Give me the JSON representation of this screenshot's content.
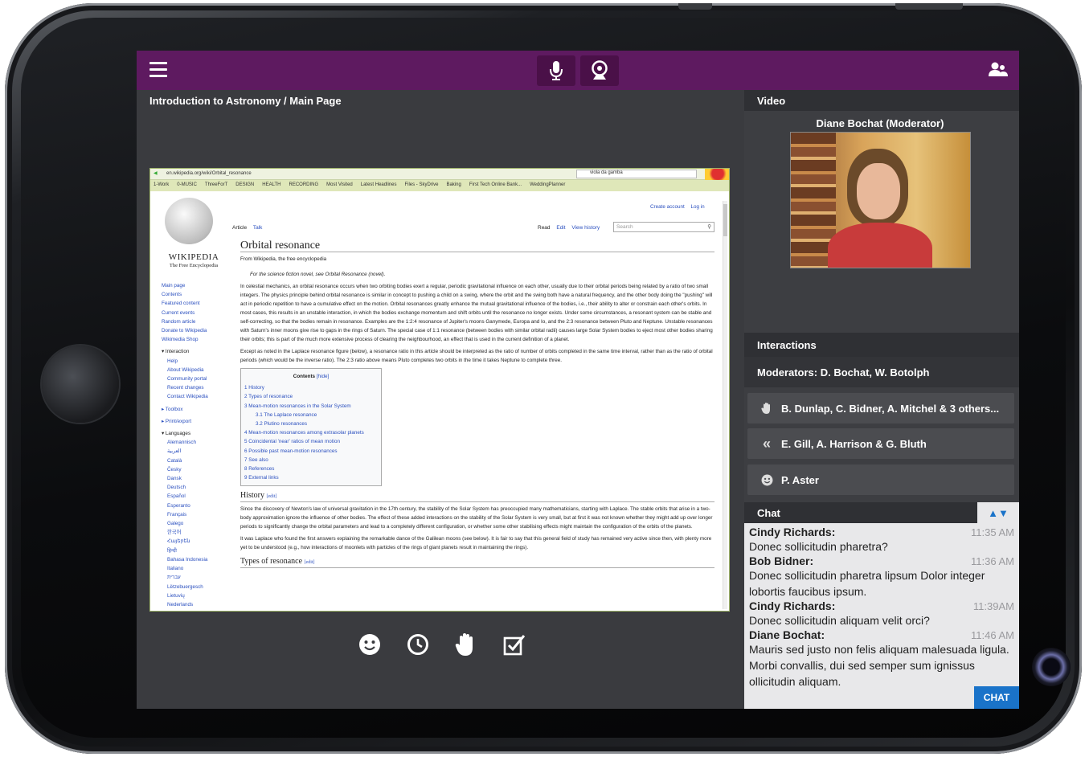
{
  "header": {
    "page_title": "Introduction to Astronomy / Main Page",
    "menu_icon": "hamburger-menu-icon",
    "mic_icon": "microphone-icon",
    "webcam_icon": "webcam-icon",
    "users_icon": "users-icon"
  },
  "video": {
    "section_title": "Video",
    "presenter": "Diane Bochat (Moderator)"
  },
  "interactions": {
    "section_title": "Interactions",
    "moderators": "Moderators: D. Bochat, W. Botolph",
    "rows": [
      {
        "icon": "raised-hand-icon",
        "label": "B. Dunlap, C. Bidner, A. Mitchel & 3 others..."
      },
      {
        "icon": "slower-icon",
        "label": "E. Gill, A. Harrison & G. Bluth"
      },
      {
        "icon": "smiley-icon",
        "label": "P. Aster"
      }
    ]
  },
  "chat": {
    "section_title": "Chat",
    "toggle_label": "▲▼",
    "button_label": "CHAT",
    "messages": [
      {
        "author": "Cindy Richards:",
        "time": "11:35 AM",
        "text": "Donec sollicitudin pharetra?"
      },
      {
        "author": "Bob Bidner:",
        "time": "11:36 AM",
        "text": "Donec sollicitudin pharetra lipsum Dolor integer lobortis faucibus ipsum."
      },
      {
        "author": "Cindy Richards:",
        "time": "11:39AM",
        "text": "Donec sollicitudin aliquam velit orci?"
      },
      {
        "author": "Diane Bochat:",
        "time": "11:46 AM",
        "text": "Mauris sed justo non felis aliquam malesuada ligula. Morbi convallis, dui sed semper sum ignissus ollicitudin aliquam."
      }
    ]
  },
  "bottom_tools": [
    "smiley-icon",
    "clock-icon",
    "raised-hand-icon",
    "checkbox-icon"
  ],
  "browser": {
    "url": "en.wikipedia.org/wiki/Orbital_resonance",
    "search_engine_text": "viola da gamba",
    "bookmarks": [
      "1-Work",
      "0-MUSIC",
      "ThreeForT",
      "DESIGN",
      "HEALTH",
      "RECORDING",
      "Most Visited",
      "Latest Headlines",
      "Files - SkyDrive",
      "Baking",
      "First Tech Online Bank...",
      "WeddingPlanner"
    ]
  },
  "wiki": {
    "logo_title": "WIKIPEDIA",
    "logo_subtitle": "The Free Encyclopedia",
    "create_account": "Create account",
    "log_in": "Log in",
    "tab_article": "Article",
    "tab_talk": "Talk",
    "tab_read": "Read",
    "tab_edit": "Edit",
    "tab_history": "View history",
    "search_placeholder": "Search",
    "nav_main": [
      "Main page",
      "Contents",
      "Featured content",
      "Current events",
      "Random article",
      "Donate to Wikipedia",
      "Wikimedia Shop"
    ],
    "nav_interaction_head": "Interaction",
    "nav_interaction": [
      "Help",
      "About Wikipedia",
      "Community portal",
      "Recent changes",
      "Contact Wikipedia"
    ],
    "nav_toolbox": "Toolbox",
    "nav_print": "Print/export",
    "nav_languages_head": "Languages",
    "nav_languages": [
      "Alemannisch",
      "العربية",
      "Català",
      "Česky",
      "Dansk",
      "Deutsch",
      "Español",
      "Esperanto",
      "Français",
      "Galego",
      "한국어",
      "Հայերեն",
      "हिन्दी",
      "Bahasa Indonesia",
      "Italiano",
      "עברית",
      "Lëtzebuergesch",
      "Lietuvių",
      "Nederlands"
    ],
    "article_title": "Orbital resonance",
    "from_line": "From Wikipedia, the free encyclopedia",
    "hatnote": "For the science fiction novel, see Orbital Resonance (novel).",
    "para1": "In celestial mechanics, an orbital resonance occurs when two orbiting bodies exert a regular, periodic gravitational influence on each other, usually due to their orbital periods being related by a ratio of two small integers. The physics principle behind orbital resonance is similar in concept to pushing a child on a swing, where the orbit and the swing both have a natural frequency, and the other body doing the \"pushing\" will act in periodic repetition to have a cumulative effect on the motion. Orbital resonances greatly enhance the mutual gravitational influence of the bodies, i.e., their ability to alter or constrain each other's orbits. In most cases, this results in an unstable interaction, in which the bodies exchange momentum and shift orbits until the resonance no longer exists. Under some circumstances, a resonant system can be stable and self-correcting, so that the bodies remain in resonance. Examples are the 1:2:4 resonance of Jupiter's moons Ganymede, Europa and Io, and the 2:3 resonance between Pluto and Neptune. Unstable resonances with Saturn's inner moons give rise to gaps in the rings of Saturn. The special case of 1:1 resonance (between bodies with similar orbital radii) causes large Solar System bodies to eject most other bodies sharing their orbits; this is part of the much more extensive process of clearing the neighbourhood, an effect that is used in the current definition of a planet.",
    "para2": "Except as noted in the Laplace resonance figure (below), a resonance ratio in this article should be interpreted as the ratio of number of orbits completed in the same time interval, rather than as the ratio of orbital periods (which would be the inverse ratio). The 2:3 ratio above means Pluto completes two orbits in the time it takes Neptune to complete three.",
    "toc_title": "Contents",
    "toc_hide": "[hide]",
    "toc": [
      "1 History",
      "2 Types of resonance",
      "3 Mean-motion resonances in the Solar System",
      "3.1 The Laplace resonance",
      "3.2 Plutino resonances",
      "4 Mean-motion resonances among extrasolar planets",
      "5 Coincidental 'near' ratios of mean motion",
      "6 Possible past mean-motion resonances",
      "7 See also",
      "8 References",
      "9 External links"
    ],
    "history_head": "History",
    "edit_tag": "[edit]",
    "history_p1": "Since the discovery of Newton's law of universal gravitation in the 17th century, the stability of the Solar System has preoccupied many mathematicians, starting with Laplace. The stable orbits that arise in a two-body approximation ignore the influence of other bodies. The effect of these added interactions on the stability of the Solar System is very small, but at first it was not known whether they might add up over longer periods to significantly change the orbital parameters and lead to a completely different configuration, or whether some other stabilising effects might maintain the configuration of the orbits of the planets.",
    "history_p2": "It was Laplace who found the first answers explaining the remarkable dance of the Galilean moons (see below). It is fair to say that this general field of study has remained very active since then, with plenty more yet to be understood (e.g., how interactions of moonlets with particles of the rings of giant planets result in maintaining the rings).",
    "types_head": "Types of resonance"
  }
}
